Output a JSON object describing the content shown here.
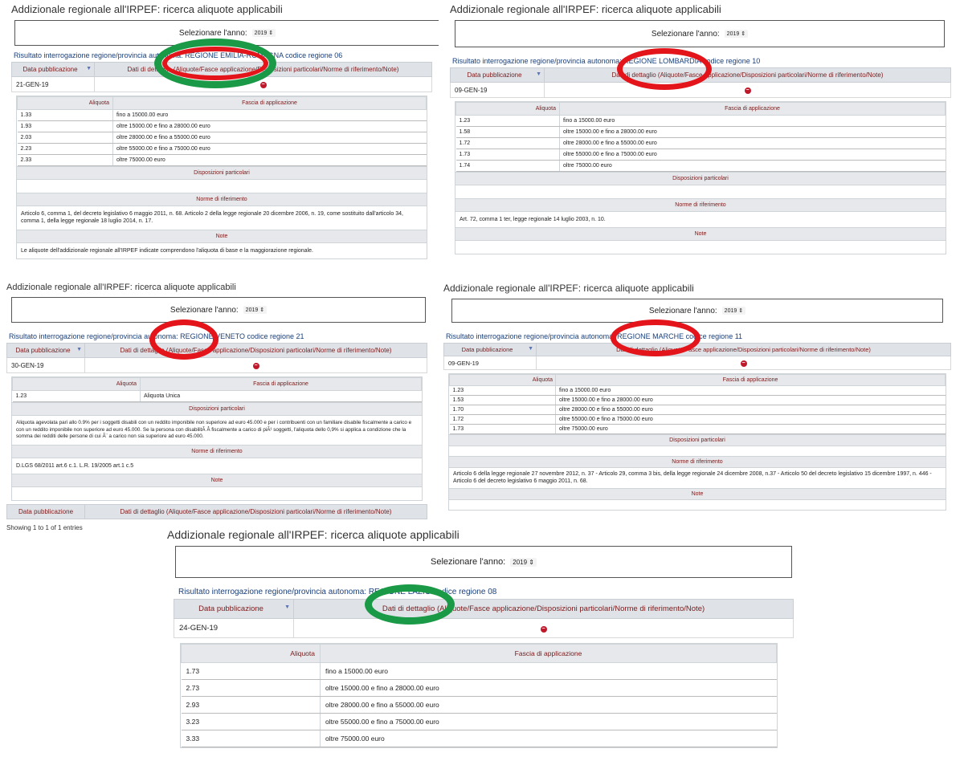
{
  "common": {
    "page_title": "Addizionale regionale all'IRPEF: ricerca aliquote applicabili",
    "select_year_label": "Selezionare l'anno:",
    "year_value": "2019",
    "result_prefix": "Risultato interrogazione regione/provincia autonoma: ",
    "code_prefix": " codice regione ",
    "col_date": "Data pubblicazione",
    "col_details": "Dati di dettaglio (Aliquote/Fasce applicazione/Disposizioni particolari/Norme di riferimento/Note)",
    "col_rate": "Aliquota",
    "col_band": "Fascia di applicazione",
    "sec_special": "Disposizioni particolari",
    "sec_norms": "Norme di riferimento",
    "sec_notes": "Note",
    "entries_info": "Showing 1 to 1 of 1 entries"
  },
  "colors": {
    "highlight_ok": "#1a9a46",
    "highlight_bad": "#e3141a",
    "header_text": "#7a1a1a",
    "link_blue": "#1a3f7a"
  },
  "panels": [
    {
      "region": "REGIONE EMILIA-ROMAGNA",
      "code": "06",
      "date": "21-GEN-19",
      "highlight": "green",
      "rates": [
        {
          "rate": "1.33",
          "band": "fino a 15000.00 euro"
        },
        {
          "rate": "1.93",
          "band": "oltre 15000.00 e fino a 28000.00 euro"
        },
        {
          "rate": "2.03",
          "band": "oltre 28000.00 e fino a 55000.00 euro"
        },
        {
          "rate": "2.23",
          "band": "oltre 55000.00 e fino a 75000.00 euro"
        },
        {
          "rate": "2.33",
          "band": "oltre 75000.00 euro"
        }
      ],
      "special": "",
      "norms": "Articolo 6, comma 1, del decreto legislativo 6 maggio 2011, n. 68. Articolo 2 della legge regionale 20 dicembre 2006, n. 19, come sostituito dall'articolo 34, comma 1, della legge regionale 18 luglio 2014, n. 17.",
      "notes": "Le aliquote dell'addizionale regionale all'IRPEF indicate comprendono l'aliquota di base e la maggiorazione regionale."
    },
    {
      "region": "REGIONE LOMBARDIA",
      "code": "10",
      "date": "09-GEN-19",
      "highlight": "red",
      "rates": [
        {
          "rate": "1.23",
          "band": "fino a 15000.00 euro"
        },
        {
          "rate": "1.58",
          "band": "oltre 15000.00 e fino a 28000.00 euro"
        },
        {
          "rate": "1.72",
          "band": "oltre 28000.00 e fino a 55000.00 euro"
        },
        {
          "rate": "1.73",
          "band": "oltre 55000.00 e fino a 75000.00 euro"
        },
        {
          "rate": "1.74",
          "band": "oltre 75000.00 euro"
        }
      ],
      "special": "",
      "norms": "Art. 72, comma 1 ter, legge regionale 14 luglio 2003, n. 10.",
      "notes": ""
    },
    {
      "region": "REGIONE VENETO",
      "code": "21",
      "date": "30-GEN-19",
      "highlight": "red",
      "rates": [
        {
          "rate": "1.23",
          "band": "Aliquota Unica"
        }
      ],
      "special": "Aliquota agevolata pari allo 0.9% per i soggetti disabili con un reddito imponibile non superiore ad euro 45.000 e per i contribuenti con un familiare disabile fiscalmente a carico e con un reddito imponibile non superiore ad euro 45.000. Se la persona con disabilitÃ Â fiscalmente a carico di piÃ¹ soggetti, l'aliquota dello 0,9% si applica a condizione che la somma dei redditi delle persone di cui Ã¨ a carico non sia superiore ad euro 45.000.",
      "norms": "D.LGS 68/2011 art.6 c.1. L.R. 19/2005 art.1 c.5",
      "notes": ""
    },
    {
      "region": "REGIONE MARCHE",
      "code": "11",
      "date": "09-GEN-19",
      "highlight": "red",
      "rates": [
        {
          "rate": "1.23",
          "band": "fino a 15000.00 euro"
        },
        {
          "rate": "1.53",
          "band": "oltre 15000.00 e fino a 28000.00 euro"
        },
        {
          "rate": "1.70",
          "band": "oltre 28000.00 e fino a 55000.00 euro"
        },
        {
          "rate": "1.72",
          "band": "oltre 55000.00 e fino a 75000.00 euro"
        },
        {
          "rate": "1.73",
          "band": "oltre 75000.00 euro"
        }
      ],
      "special": "",
      "norms": "Articolo 6 della legge regionale 27 novembre 2012, n. 37 - Articolo 29, comma 3 bis, della legge regionale 24 dicembre 2008, n.37 - Articolo 50 del decreto legislativo 15 dicembre 1997, n. 446 - Articolo 6 del decreto legislativo 6 maggio 2011, n. 68.",
      "notes": ""
    },
    {
      "region": "REGIONE LAZIO",
      "code": "08",
      "date": "24-GEN-19",
      "highlight": "green",
      "rates": [
        {
          "rate": "1.73",
          "band": "fino a 15000.00 euro"
        },
        {
          "rate": "2.73",
          "band": "oltre 15000.00 e fino a 28000.00 euro"
        },
        {
          "rate": "2.93",
          "band": "oltre 28000.00 e fino a 55000.00 euro"
        },
        {
          "rate": "3.23",
          "band": "oltre 55000.00 e fino a 75000.00 euro"
        },
        {
          "rate": "3.33",
          "band": "oltre 75000.00 euro"
        }
      ]
    }
  ]
}
